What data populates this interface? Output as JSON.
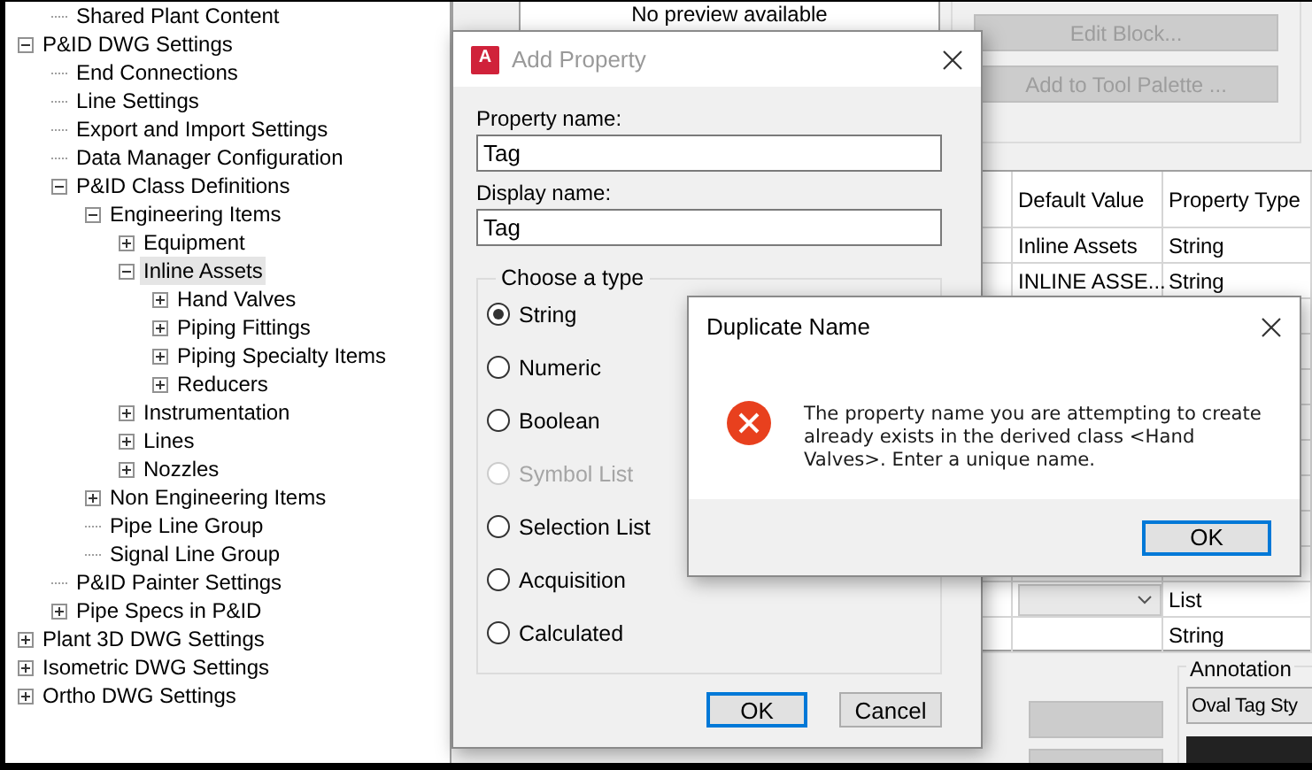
{
  "tree": {
    "partial_items": [
      {
        "label": "Shared Plant Content",
        "selected": false
      }
    ],
    "items": [
      {
        "label": "P&ID DWG Settings",
        "expanded": true,
        "selected": false,
        "children": [
          {
            "label": "End Connections",
            "selected": false
          },
          {
            "label": "Line Settings",
            "selected": false
          },
          {
            "label": "Export and Import Settings",
            "selected": false
          },
          {
            "label": "Data Manager Configuration",
            "selected": false
          },
          {
            "label": "P&ID Class Definitions",
            "expanded": true,
            "selected": false,
            "children": [
              {
                "label": "Engineering Items",
                "expanded": true,
                "selected": false,
                "children": [
                  {
                    "label": "Equipment",
                    "expanded": false,
                    "selected": false
                  },
                  {
                    "label": "Inline Assets",
                    "expanded": true,
                    "selected": true,
                    "children": [
                      {
                        "label": "Hand Valves",
                        "expanded": false,
                        "selected": false
                      },
                      {
                        "label": "Piping Fittings",
                        "expanded": false,
                        "selected": false
                      },
                      {
                        "label": "Piping Specialty Items",
                        "expanded": false,
                        "selected": false
                      },
                      {
                        "label": "Reducers",
                        "expanded": false,
                        "selected": false
                      }
                    ]
                  },
                  {
                    "label": "Instrumentation",
                    "expanded": false,
                    "selected": false
                  },
                  {
                    "label": "Lines",
                    "expanded": false,
                    "selected": false
                  },
                  {
                    "label": "Nozzles",
                    "expanded": false,
                    "selected": false
                  }
                ]
              },
              {
                "label": "Non Engineering Items",
                "expanded": false,
                "selected": false
              },
              {
                "label": "Pipe Line Group",
                "selected": false
              },
              {
                "label": "Signal Line Group",
                "selected": false
              }
            ]
          },
          {
            "label": "P&ID Painter Settings",
            "selected": false
          },
          {
            "label": "Pipe Specs in P&ID",
            "expanded": false,
            "selected": false
          }
        ]
      },
      {
        "label": "Plant 3D DWG Settings",
        "expanded": false,
        "selected": false
      },
      {
        "label": "Isometric DWG Settings",
        "expanded": false,
        "selected": false
      },
      {
        "label": "Ortho DWG Settings",
        "expanded": false,
        "selected": false
      }
    ]
  },
  "preview": {
    "text": "No preview available"
  },
  "block_buttons": [
    {
      "label": "Edit Block...",
      "disabled": true
    },
    {
      "label": "Add to Tool Palette ...",
      "disabled": true
    }
  ],
  "properties_table": {
    "columns": [
      "Default Value",
      "Property Type"
    ],
    "rows_top": [
      {
        "default_value": "Inline Assets",
        "property_type": "String"
      },
      {
        "default_value": "INLINE ASSE...",
        "property_type": "String"
      }
    ],
    "rows_bottom": [
      {
        "kind": "dropdown",
        "property_type": "List"
      },
      {
        "kind": "text",
        "property_type": "String"
      }
    ]
  },
  "annotation": {
    "label": "Annotation",
    "style": "Oval Tag Sty"
  },
  "add_property_dialog": {
    "title": "Add Property",
    "active": false,
    "app_icon_letter": "A",
    "property_name_label": "Property name:",
    "property_name": "Tag",
    "display_name_label": "Display name:",
    "display_name": "Tag",
    "type_group": "Choose a type",
    "types": [
      {
        "label": "String",
        "selected": true,
        "disabled": false
      },
      {
        "label": "Numeric",
        "selected": false,
        "disabled": false
      },
      {
        "label": "Boolean",
        "selected": false,
        "disabled": false
      },
      {
        "label": "Symbol List",
        "selected": false,
        "disabled": true
      },
      {
        "label": "Selection List",
        "selected": false,
        "disabled": false
      },
      {
        "label": "Acquisition",
        "selected": false,
        "disabled": false
      },
      {
        "label": "Calculated",
        "selected": false,
        "disabled": false
      }
    ],
    "buttons": [
      {
        "label": "OK",
        "default": true
      },
      {
        "label": "Cancel",
        "default": false
      }
    ]
  },
  "duplicate_dialog": {
    "title": "Duplicate Name",
    "active": true,
    "message": "The property name you are attempting to create already exists in the derived class <Hand Valves>. Enter a unique name.",
    "buttons": [
      {
        "label": "OK",
        "default": true
      }
    ]
  }
}
